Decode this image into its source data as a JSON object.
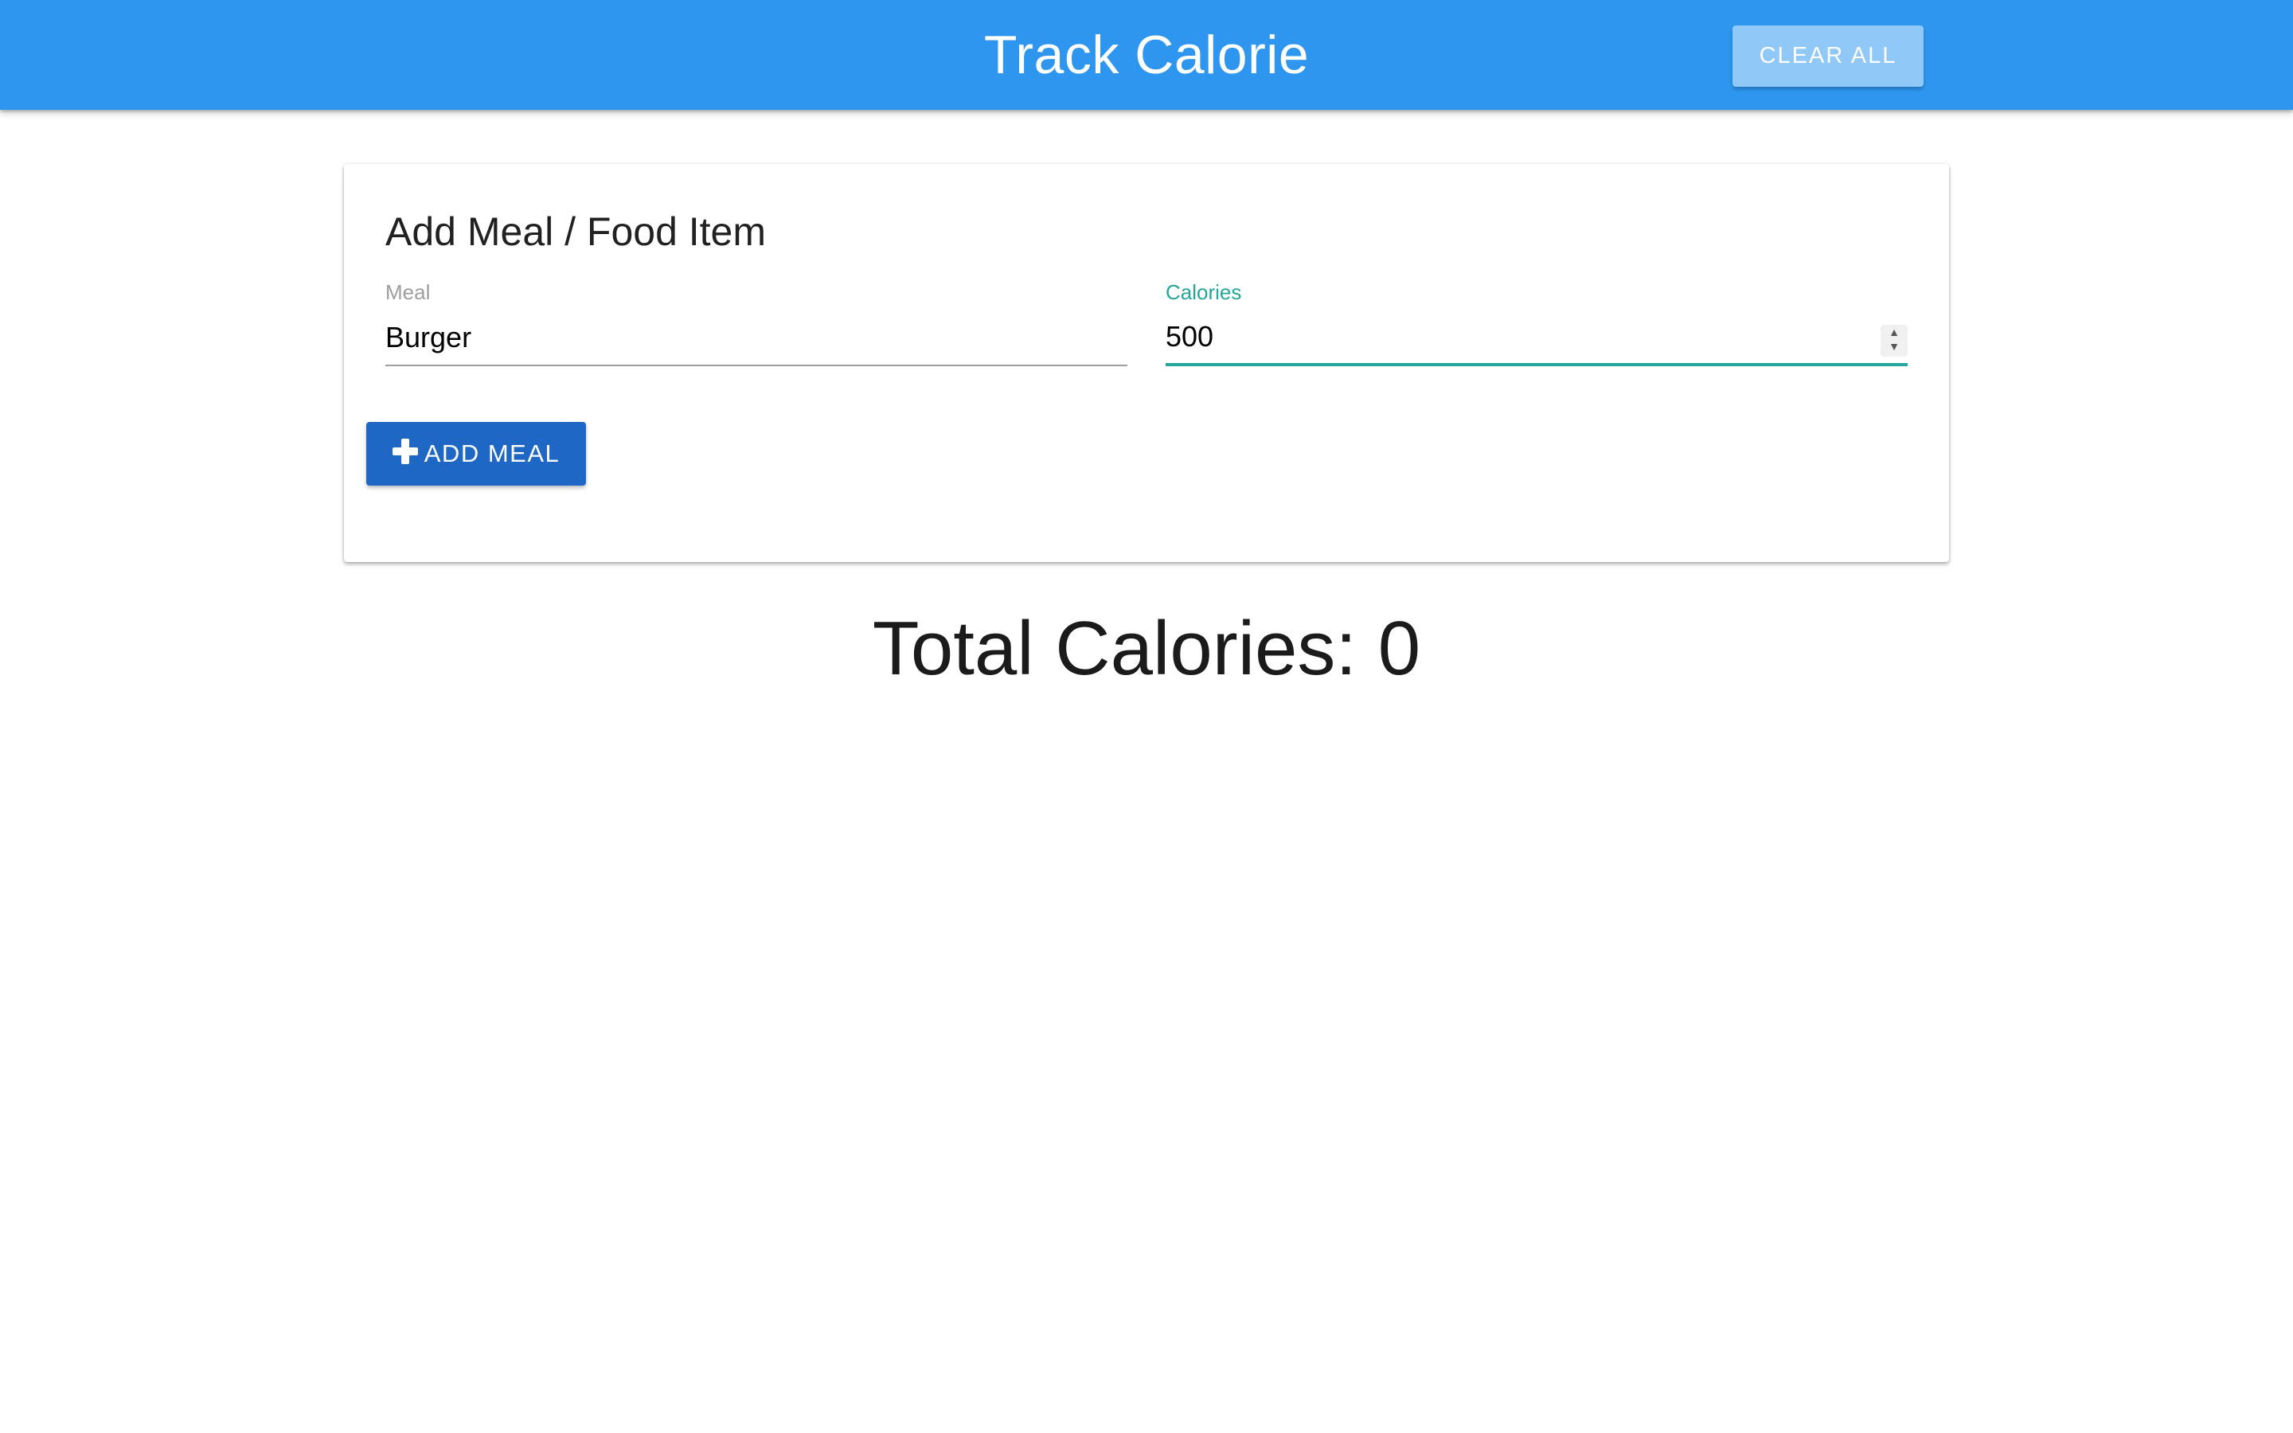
{
  "navbar": {
    "brand": "Track Calorie",
    "clear_all_label": "Clear All",
    "color": "#2e96ee"
  },
  "form": {
    "title": "Add Meal / Food Item",
    "meal": {
      "label": "Meal",
      "value": "Burger"
    },
    "calories": {
      "label": "Calories",
      "value": "500",
      "focus_color": "#26a69a"
    },
    "add_meal_label": "Add Meal",
    "add_meal_icon": "plus-icon",
    "button_color": "#1f67c4"
  },
  "total": {
    "text": "Total Calories: 0"
  }
}
